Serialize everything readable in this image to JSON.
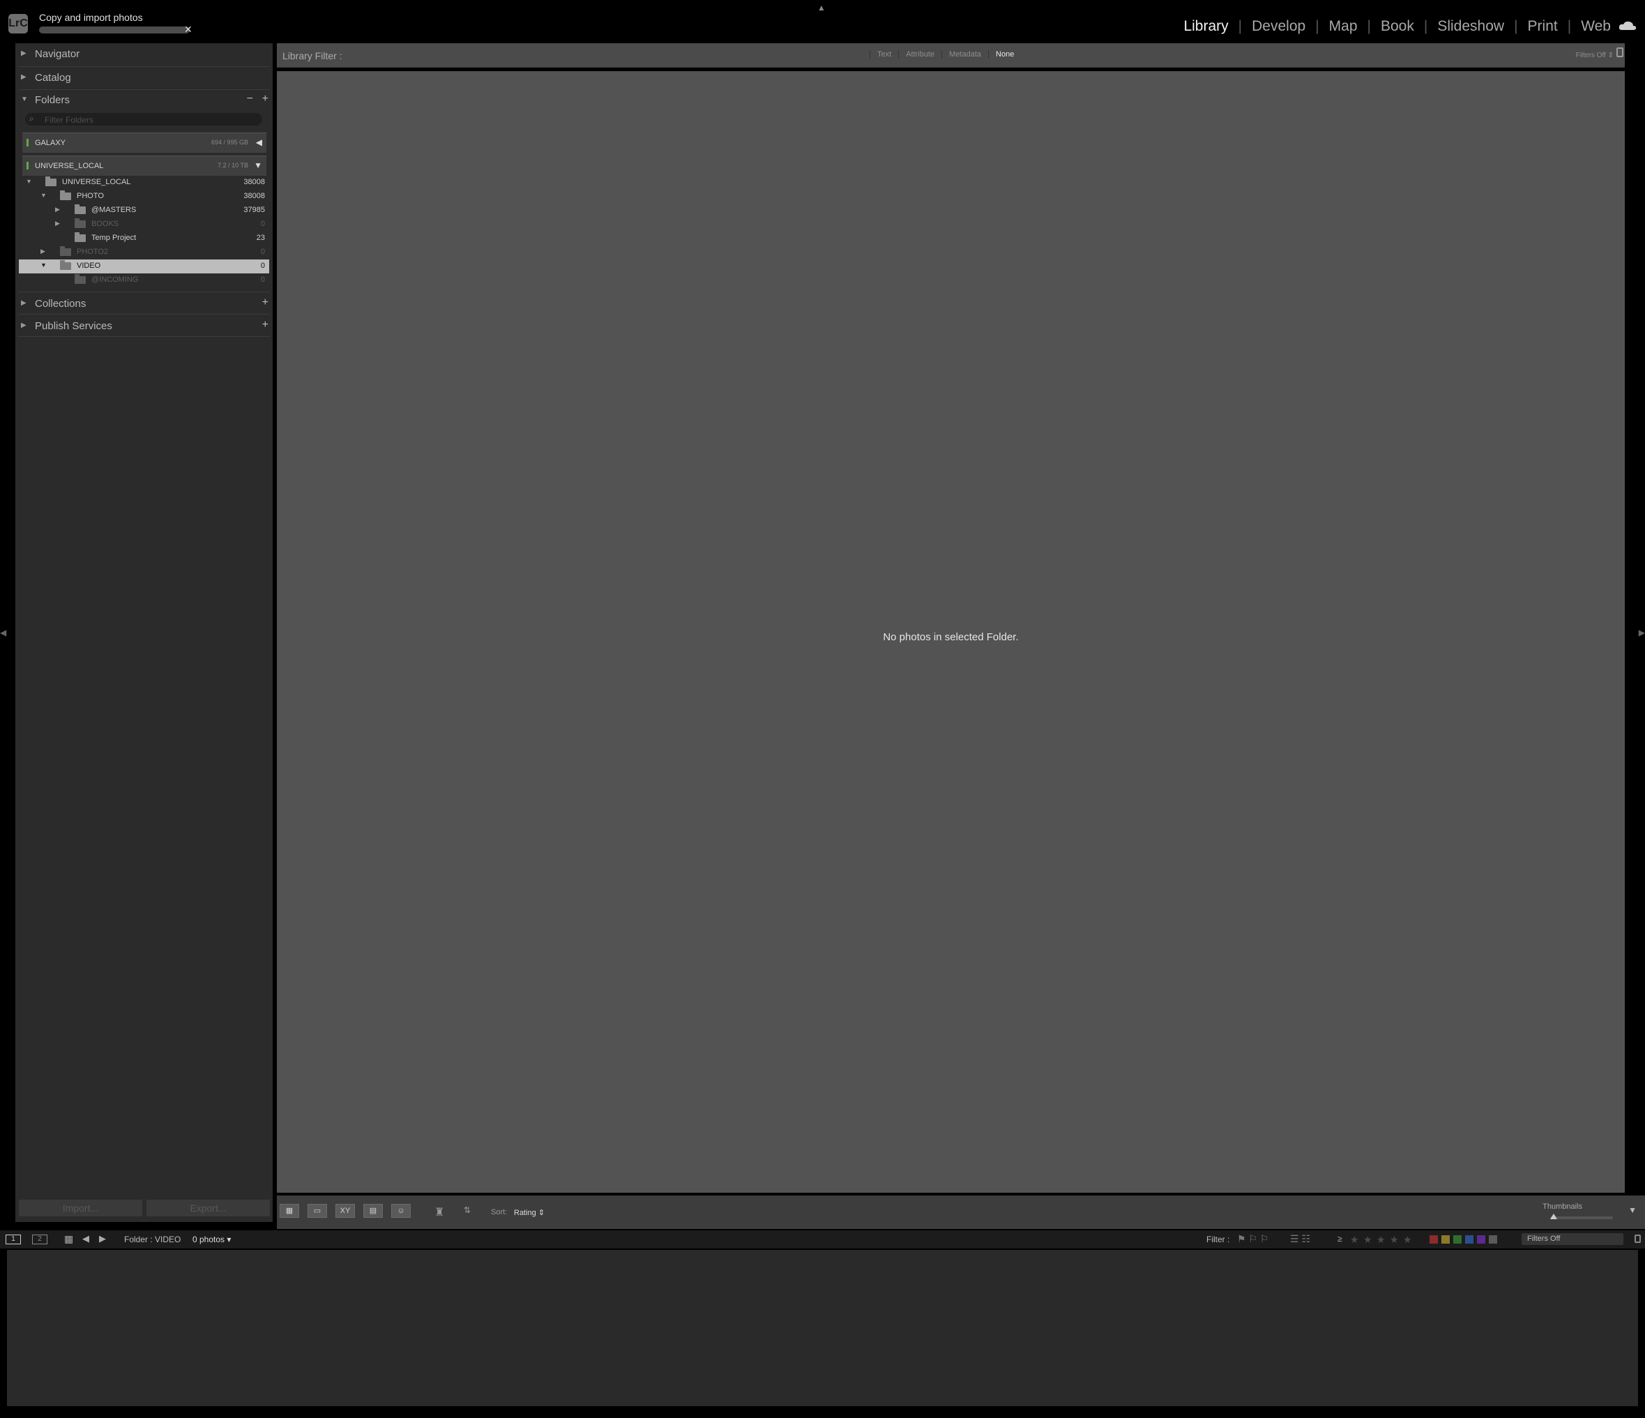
{
  "titlebar": {
    "app_logo": "LrC",
    "import_task": "Copy and import photos",
    "import_progress": 0.0,
    "cancel_icon": "close-icon"
  },
  "modules": [
    "Library",
    "Develop",
    "Map",
    "Book",
    "Slideshow",
    "Print",
    "Web"
  ],
  "active_module": "Library",
  "left_panel": {
    "navigator": "Navigator",
    "catalog": "Catalog",
    "folders": "Folders",
    "folder_search_placeholder": "Filter Folders",
    "volumes": [
      {
        "name": "GALAXY",
        "space": "694 / 995 GB"
      },
      {
        "name": "UNIVERSE_LOCAL",
        "space": "7.2 / 10 TB"
      }
    ],
    "folder_tree": [
      {
        "name": "UNIVERSE_LOCAL",
        "count": "38008"
      },
      {
        "name": "PHOTO",
        "count": "38008"
      },
      {
        "name": "@MASTERS",
        "count": "37985"
      },
      {
        "name": "BOOKS",
        "count": "0"
      },
      {
        "name": "Temp Project",
        "count": "23"
      },
      {
        "name": "PHOTO2",
        "count": "0"
      },
      {
        "name": "VIDEO",
        "count": "0"
      },
      {
        "name": "@INCOMING",
        "count": "0"
      }
    ],
    "collections": "Collections",
    "publish_services": "Publish Services",
    "import_button": "Import...",
    "export_button": "Export..."
  },
  "library_filter": {
    "label": "Library Filter :",
    "tabs": [
      "Text",
      "Attribute",
      "Metadata",
      "None"
    ],
    "active_tab": "None",
    "preset": "Filters Off"
  },
  "grid": {
    "empty_message": "No photos in selected Folder."
  },
  "toolbar": {
    "sort_label": "Sort:",
    "sort_value": "Rating",
    "thumbnails_label": "Thumbnails"
  },
  "filmstrip_bar": {
    "screen1": "1",
    "screen2": "2",
    "source": "Folder : VIDEO",
    "photo_count": "0 photos",
    "filter_label": "Filter :",
    "filter_preset": "Filters Off",
    "rating_op": "≥",
    "label_colors": [
      "#8c2b2b",
      "#8c7a2b",
      "#2f6d2f",
      "#2b4e8c",
      "#5a2b8c",
      "#5a5a5a"
    ]
  },
  "colors": {
    "bg": "#000000",
    "panel": "#2b2b2b",
    "grid": "#535353",
    "selected_row": "#bdbdbd"
  }
}
